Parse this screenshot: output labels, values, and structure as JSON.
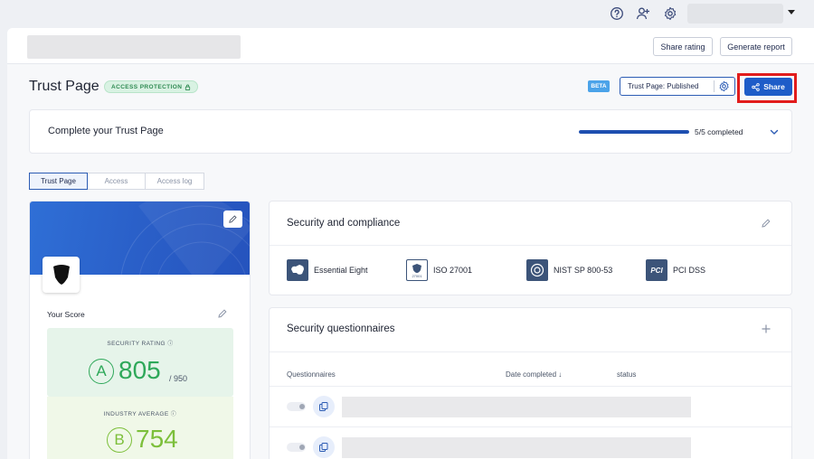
{
  "topbar": {
    "icons": [
      "help-icon",
      "add-user-icon",
      "settings-icon"
    ]
  },
  "header": {
    "share_rating_label": "Share rating",
    "generate_report_label": "Generate report"
  },
  "page": {
    "title": "Trust Page",
    "access_badge": "ACCESS PROTECTION",
    "beta_label": "BETA",
    "trust_status": "Trust Page: Published",
    "share_label": "Share"
  },
  "complete": {
    "label": "Complete your Trust Page",
    "progress": 1.0,
    "count_text": "5/5 completed"
  },
  "tabs": [
    {
      "label": "Trust Page",
      "active": true
    },
    {
      "label": "Access",
      "active": false
    },
    {
      "label": "Access log",
      "active": false
    }
  ],
  "score": {
    "label": "Your Score",
    "security_rating_caption": "SECURITY RATING",
    "security_rating_grade": "A",
    "security_rating_value": "805",
    "security_rating_max": "/ 950",
    "industry_average_caption": "INDUSTRY AVERAGE",
    "industry_average_grade": "B",
    "industry_average_value": "754"
  },
  "compliance": {
    "title": "Security and compliance",
    "items": [
      {
        "label": "Essential Eight"
      },
      {
        "label": "ISO 27001",
        "sub": "27001"
      },
      {
        "label": "NIST SP 800-53"
      },
      {
        "label": "PCI DSS",
        "mark": "PCI"
      }
    ]
  },
  "questionnaires": {
    "title": "Security questionnaires",
    "col_questionnaires": "Questionnaires",
    "col_date": "Date completed",
    "col_status": "status"
  },
  "colors": {
    "primary": "#1e5cc8",
    "highlight": "#e21c1c",
    "grade_a": "#2fa85a",
    "grade_b": "#7cbf3a"
  }
}
